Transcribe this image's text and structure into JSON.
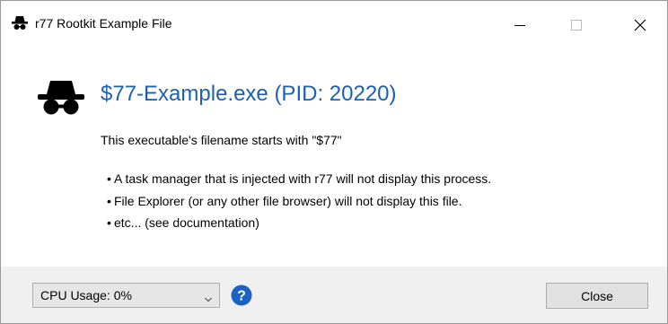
{
  "window": {
    "title": "r77 Rootkit Example File",
    "icon": "spy-icon",
    "controls": {
      "minimize": "minimize-icon",
      "maximize": "maximize-icon",
      "close": "close-icon"
    }
  },
  "main": {
    "icon": "spy-icon",
    "heading": "$77-Example.exe (PID: 20220)",
    "description": "This executable's filename starts with \"$77\"",
    "bullets": [
      "A task manager that is injected with r77 will not display this process.",
      "File Explorer (or any other file browser) will not display this file.",
      "etc... (see documentation)"
    ]
  },
  "footer": {
    "cpu_select_value": "CPU Usage: 0%",
    "help_icon": "help-icon",
    "close_label": "Close"
  },
  "colors": {
    "heading": "#1c5fb3",
    "help_badge": "#1b62c3",
    "footer_bg": "#f0f0f0"
  }
}
